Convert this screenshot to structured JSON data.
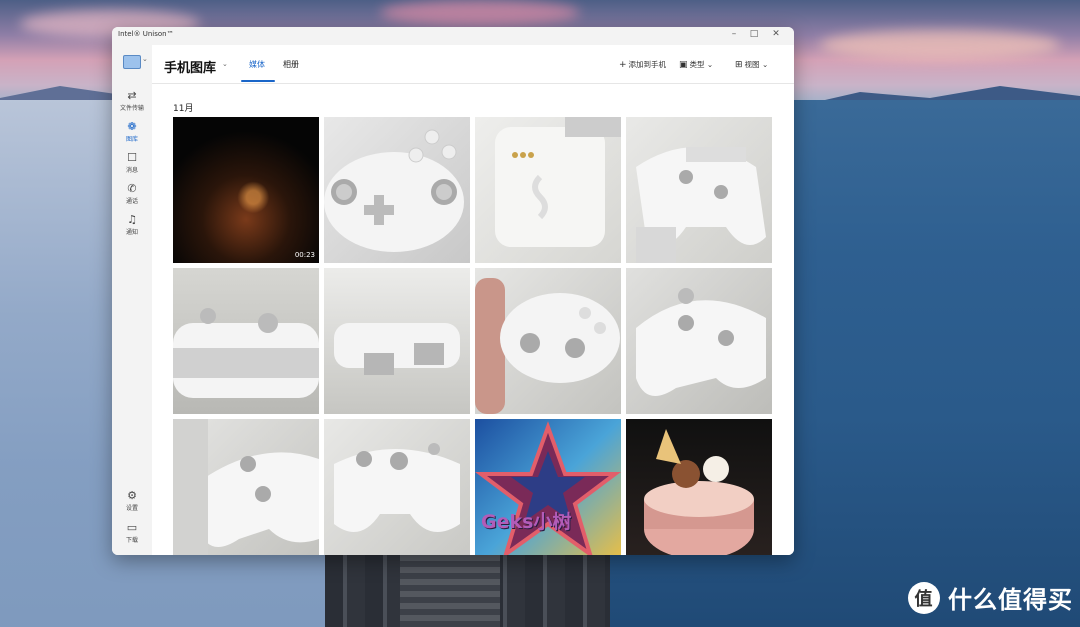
{
  "window": {
    "app_title": "Intel® Unison™",
    "controls": {
      "minimize": "–",
      "maximize": "□",
      "close": "✕"
    }
  },
  "sidebar": {
    "items": [
      {
        "label": "文件传输",
        "icon": "transfer-icon",
        "glyph": "⇄"
      },
      {
        "label": "图库",
        "icon": "gallery-icon",
        "glyph": "❁",
        "active": true
      },
      {
        "label": "消息",
        "icon": "message-icon",
        "glyph": "☐"
      },
      {
        "label": "通话",
        "icon": "phone-icon",
        "glyph": "✆"
      },
      {
        "label": "通知",
        "icon": "bell-icon",
        "glyph": "♫"
      }
    ],
    "bottom_items": [
      {
        "label": "设置",
        "icon": "gear-icon",
        "glyph": "⚙"
      },
      {
        "label": "下载",
        "icon": "folder-icon",
        "glyph": "▭"
      }
    ]
  },
  "header": {
    "title": "手机图库",
    "tabs": [
      {
        "label": "媒体",
        "active": true
      },
      {
        "label": "相册",
        "active": false
      }
    ],
    "tools": {
      "add_label": "添加到手机",
      "type_label": "类型",
      "view_label": "视图"
    }
  },
  "gallery": {
    "month": "11月",
    "video_duration": "00:23",
    "poster_text": "Geks小树",
    "items": [
      {
        "kind": "video",
        "subject": "dark campfire scene"
      },
      {
        "kind": "photo",
        "subject": "white controller close-up"
      },
      {
        "kind": "photo",
        "subject": "controller back with pins"
      },
      {
        "kind": "photo",
        "subject": "controller on stand"
      },
      {
        "kind": "photo",
        "subject": "controller top side"
      },
      {
        "kind": "photo",
        "subject": "controller side view"
      },
      {
        "kind": "photo",
        "subject": "controller in hand"
      },
      {
        "kind": "photo",
        "subject": "controller angled"
      },
      {
        "kind": "photo",
        "subject": "controller on desk"
      },
      {
        "kind": "photo",
        "subject": "controller front"
      },
      {
        "kind": "photo",
        "subject": "star poster"
      },
      {
        "kind": "photo",
        "subject": "cartoon cake"
      }
    ]
  },
  "watermark": {
    "text": "什么值得买",
    "logo": "值"
  },
  "colors": {
    "accent": "#1a66c9"
  }
}
